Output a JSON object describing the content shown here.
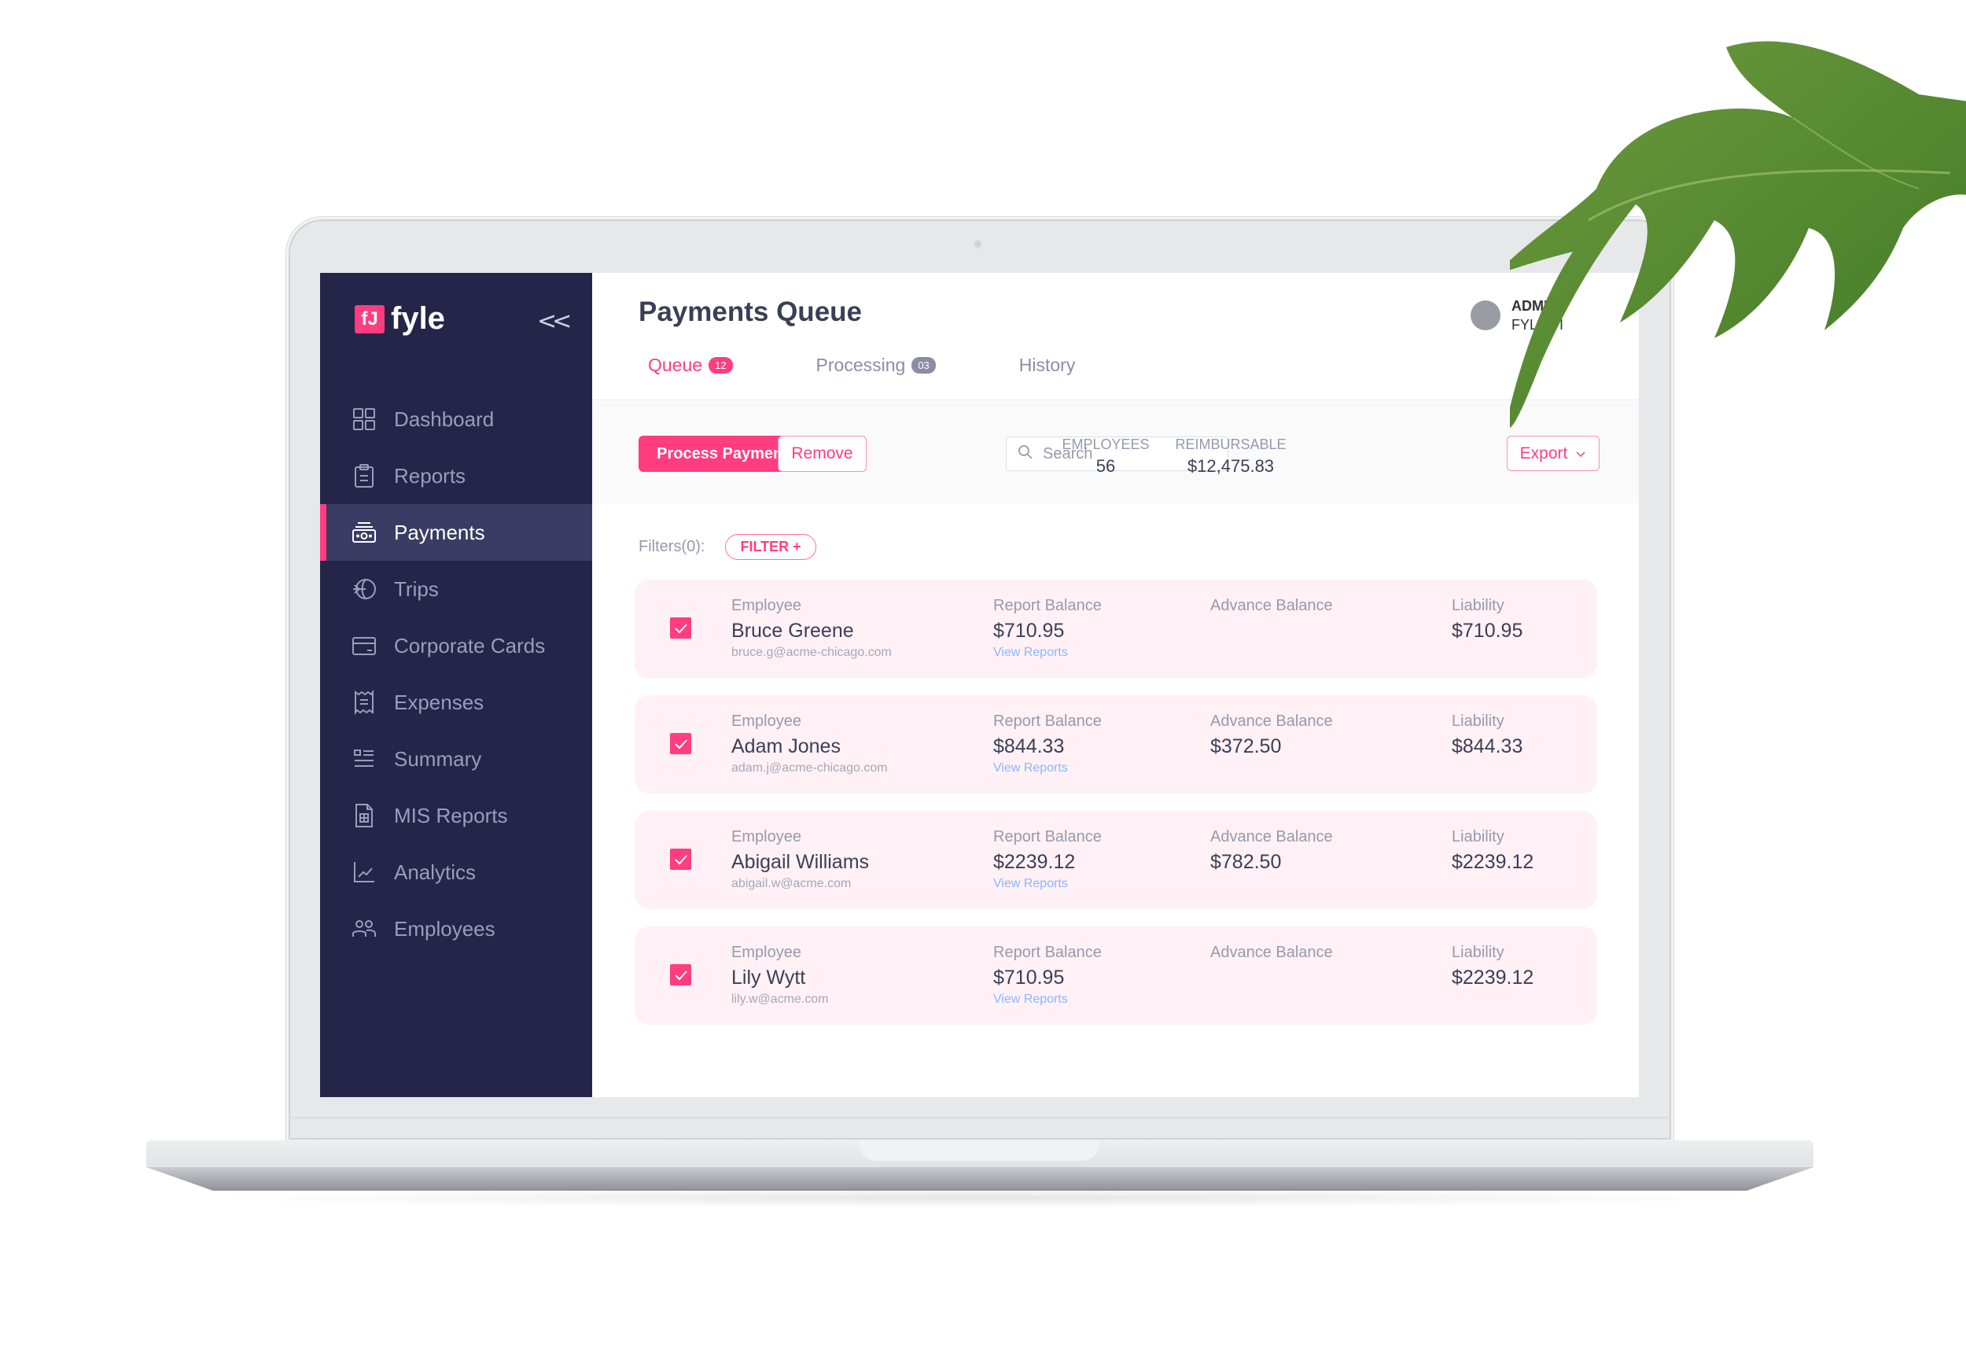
{
  "brand": {
    "logo_glyph": "fJ",
    "name": "fyle"
  },
  "sidebar": {
    "collapse_icon": "<<",
    "items": [
      {
        "label": "Dashboard",
        "icon": "grid-icon",
        "active": false
      },
      {
        "label": "Reports",
        "icon": "clipboard-icon",
        "active": false
      },
      {
        "label": "Payments",
        "icon": "money-icon",
        "active": true
      },
      {
        "label": "Trips",
        "icon": "globe-plane-icon",
        "active": false
      },
      {
        "label": "Corporate Cards",
        "icon": "credit-card-icon",
        "active": false
      },
      {
        "label": "Expenses",
        "icon": "receipt-icon",
        "active": false
      },
      {
        "label": "Summary",
        "icon": "list-icon",
        "active": false
      },
      {
        "label": "MIS Reports",
        "icon": "spreadsheet-icon",
        "active": false
      },
      {
        "label": "Analytics",
        "icon": "line-chart-icon",
        "active": false
      },
      {
        "label": "Employees",
        "icon": "users-icon",
        "active": false
      }
    ]
  },
  "header": {
    "title": "Payments Queue",
    "user_role": "ADMIN",
    "user_org": "FYLE - I"
  },
  "tabs": [
    {
      "label": "Queue",
      "count": "12",
      "active": true
    },
    {
      "label": "Processing",
      "count": "03",
      "active": false
    },
    {
      "label": "History",
      "count": null,
      "active": false
    }
  ],
  "toolbar": {
    "process_label": "Process Payment",
    "remove_label": "Remove",
    "search_placeholder": "Search",
    "employees_label": "EMPLOYEES",
    "employees_value": "56",
    "reimbursable_label": "REIMBURSABLE",
    "reimbursable_value": "$12,475.83",
    "export_label": "Export"
  },
  "filters": {
    "label": "Filters(0):",
    "button_label": "FILTER +"
  },
  "columns": {
    "employee": "Employee",
    "report_balance": "Report Balance",
    "advance_balance": "Advance Balance",
    "liability": "Liability",
    "view_reports": "View Reports"
  },
  "rows": [
    {
      "checked": true,
      "name": "Bruce Greene",
      "email": "bruce.g@acme-chicago.com",
      "report_balance": "$710.95",
      "advance_balance": "",
      "liability": "$710.95"
    },
    {
      "checked": true,
      "name": "Adam Jones",
      "email": "adam.j@acme-chicago.com",
      "report_balance": "$844.33",
      "advance_balance": "$372.50",
      "liability": "$844.33"
    },
    {
      "checked": true,
      "name": "Abigail Williams",
      "email": "abigail.w@acme.com",
      "report_balance": "$2239.12",
      "advance_balance": "$782.50",
      "liability": "$2239.12"
    },
    {
      "checked": true,
      "name": "Lily Wytt",
      "email": "lily.w@acme.com",
      "report_balance": "$710.95",
      "advance_balance": "",
      "liability": "$2239.12"
    }
  ],
  "colors": {
    "accent": "#ff3d7f",
    "sidebar_bg": "#242548",
    "sidebar_active_bg": "#3a3c63",
    "row_bg": "#fff1f6",
    "link": "#8ab6ff"
  }
}
